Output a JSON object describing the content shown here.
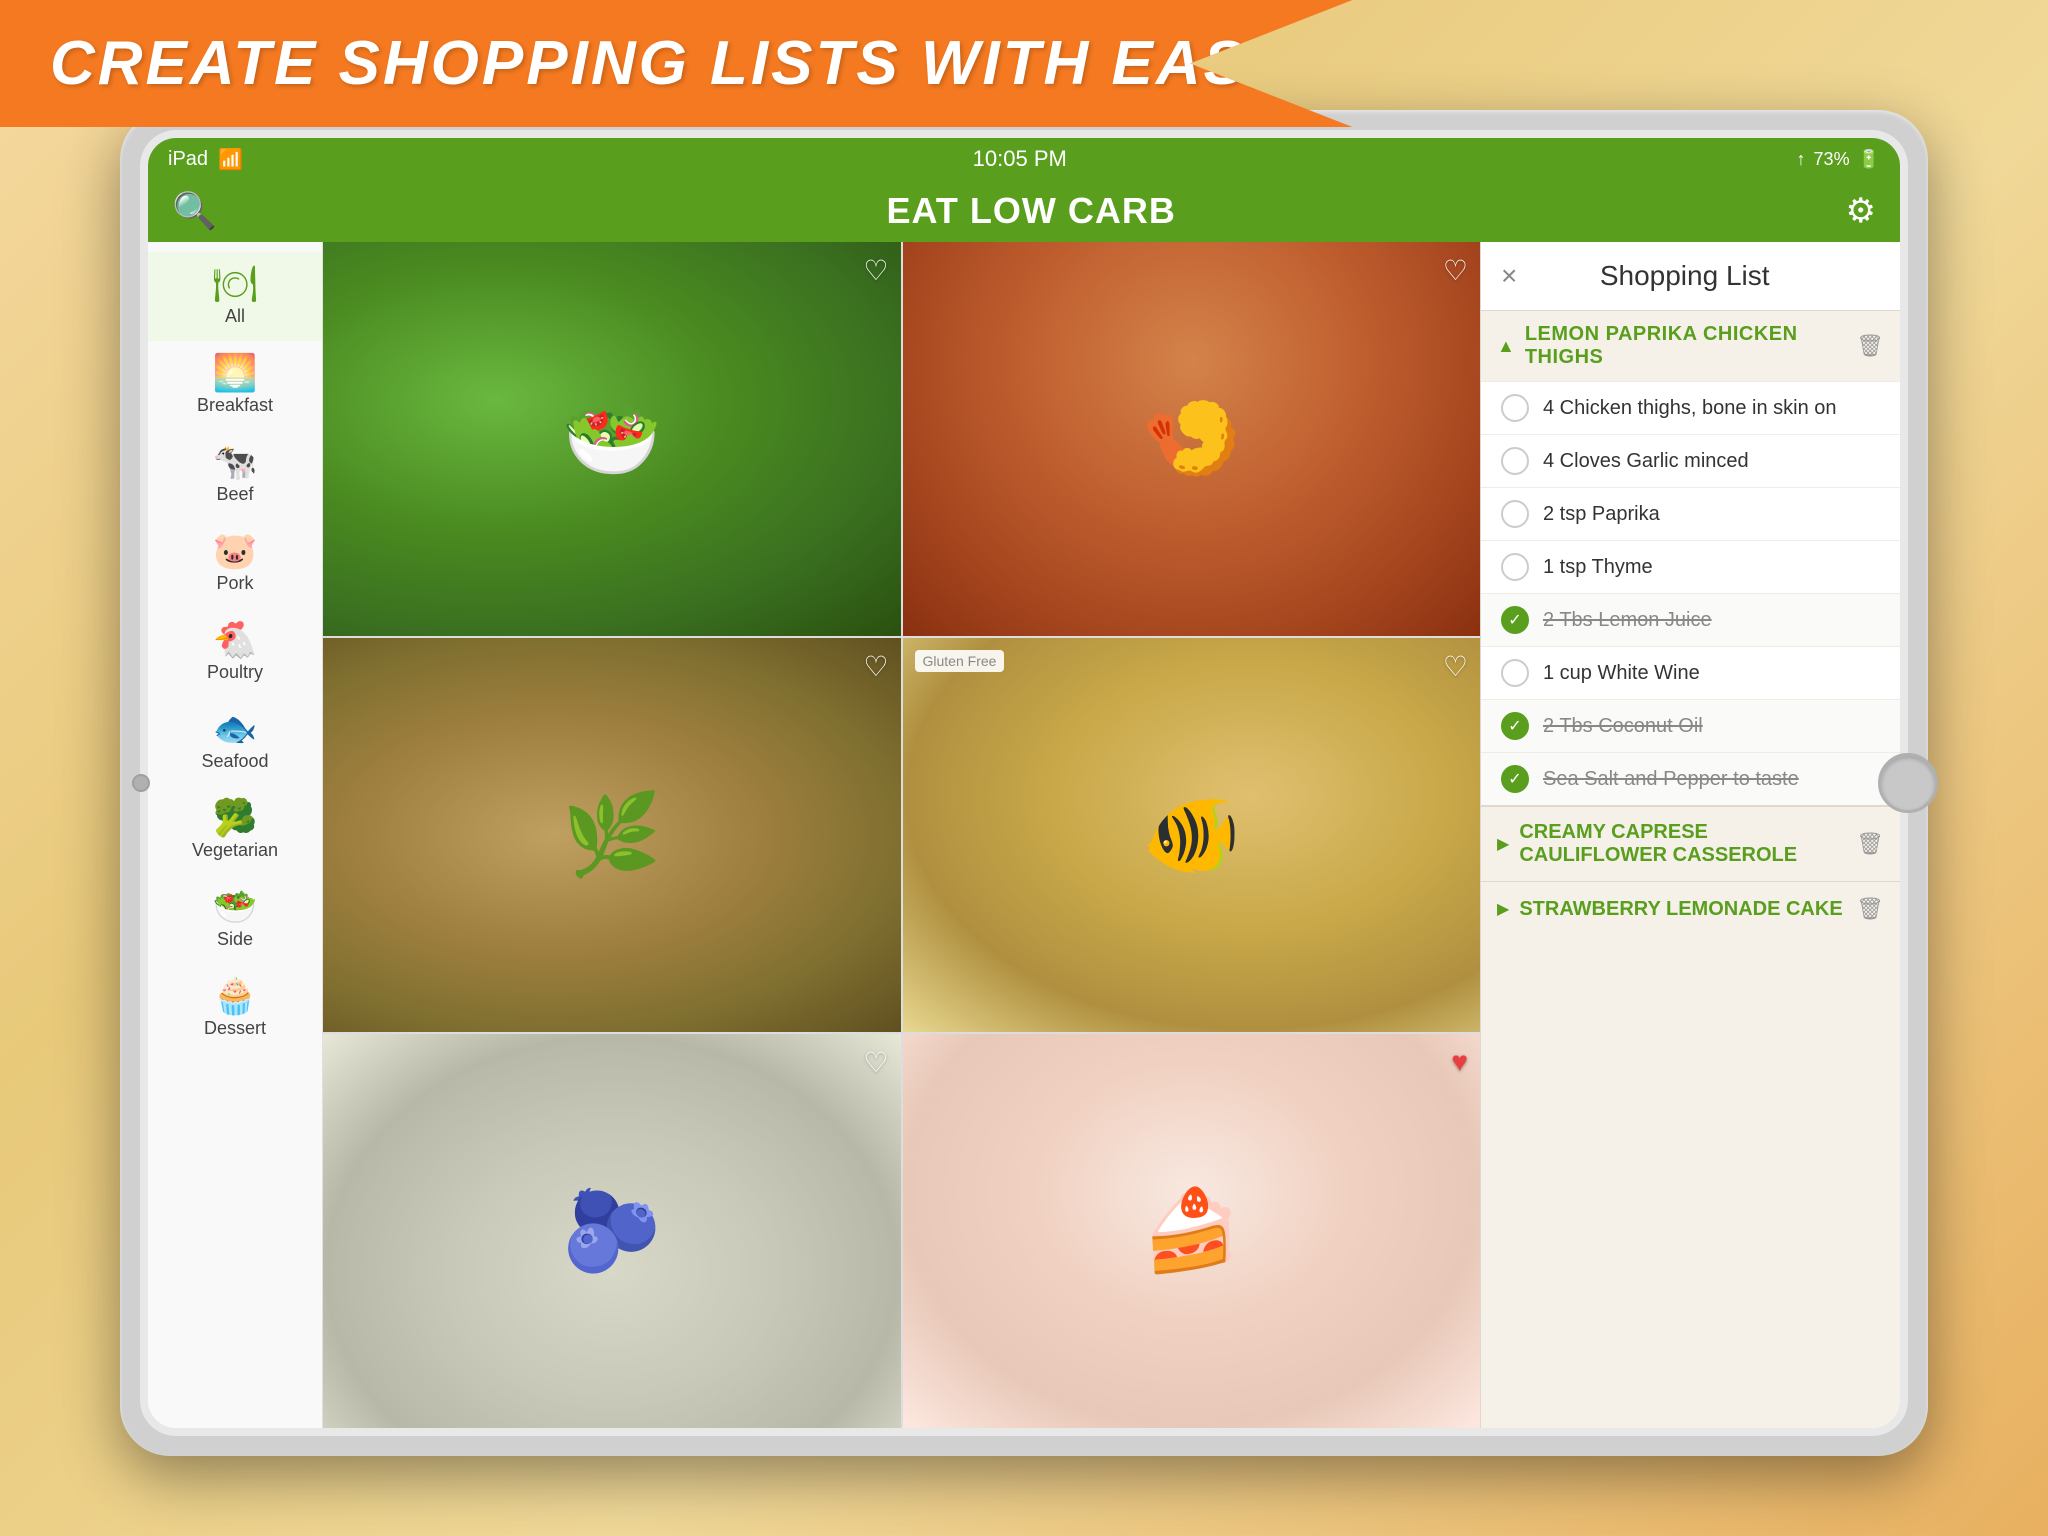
{
  "banner": {
    "text": "CREATE SHOPPING LISTS WITH EASE"
  },
  "status_bar": {
    "device": "iPad",
    "wifi": "wifi",
    "time": "10:05 PM",
    "location": "↑",
    "battery": "73%"
  },
  "nav": {
    "title_prefix": "EAT ",
    "title_bold": "LOW CARB",
    "search_label": "search",
    "gear_label": "settings"
  },
  "sidebar": {
    "items": [
      {
        "id": "all",
        "icon": "🍽",
        "label": "All",
        "active": true
      },
      {
        "id": "breakfast",
        "icon": "🌅",
        "label": "Breakfast"
      },
      {
        "id": "beef",
        "icon": "🐄",
        "label": "Beef"
      },
      {
        "id": "pork",
        "icon": "🐷",
        "label": "Pork"
      },
      {
        "id": "poultry",
        "icon": "🐔",
        "label": "Poultry"
      },
      {
        "id": "seafood",
        "icon": "🐟",
        "label": "Seafood"
      },
      {
        "id": "vegetarian",
        "icon": "🥦",
        "label": "Vegetarian"
      },
      {
        "id": "side",
        "icon": "🥗",
        "label": "Side"
      },
      {
        "id": "dessert",
        "icon": "🧁",
        "label": "Dessert"
      }
    ]
  },
  "recipes": [
    {
      "id": "salad",
      "badge": "",
      "has_heart": true
    },
    {
      "id": "shrimp",
      "badge": "",
      "has_heart": true
    },
    {
      "id": "artichoke",
      "badge": "",
      "has_heart": true
    },
    {
      "id": "fishcake",
      "badge": "Gluten Free",
      "has_heart": true
    },
    {
      "id": "blueberry",
      "badge": "",
      "has_heart": true
    },
    {
      "id": "strawberry-cake",
      "badge": "",
      "has_heart": true
    }
  ],
  "shopping_list": {
    "title": "Shopping List",
    "close_label": "×",
    "groups": [
      {
        "id": "lemon-paprika",
        "name": "LEMON PAPRIKA CHICKEN THIGHS",
        "expanded": true,
        "ingredients": [
          {
            "id": "chicken",
            "text": "4 Chicken thighs, bone in skin on",
            "checked": false
          },
          {
            "id": "garlic",
            "text": "4 Cloves Garlic minced",
            "checked": false
          },
          {
            "id": "paprika",
            "text": "2 tsp Paprika",
            "checked": false
          },
          {
            "id": "thyme",
            "text": "1 tsp Thyme",
            "checked": false
          },
          {
            "id": "lemon-juice",
            "text": "2 Tbs Lemon Juice",
            "checked": true
          },
          {
            "id": "white-wine",
            "text": "1 cup White Wine",
            "checked": false
          },
          {
            "id": "coconut-oil",
            "text": "2 Tbs Coconut Oil",
            "checked": true
          },
          {
            "id": "salt-pepper",
            "text": "Sea Salt and Pepper to taste",
            "checked": true
          }
        ]
      },
      {
        "id": "caprese",
        "name": "CREAMY CAPRESE CAULIFLOWER CASSEROLE",
        "expanded": false,
        "ingredients": []
      },
      {
        "id": "strawberry-cake",
        "name": "STRAWBERRY LEMONADE CAKE",
        "expanded": false,
        "ingredients": []
      }
    ]
  }
}
